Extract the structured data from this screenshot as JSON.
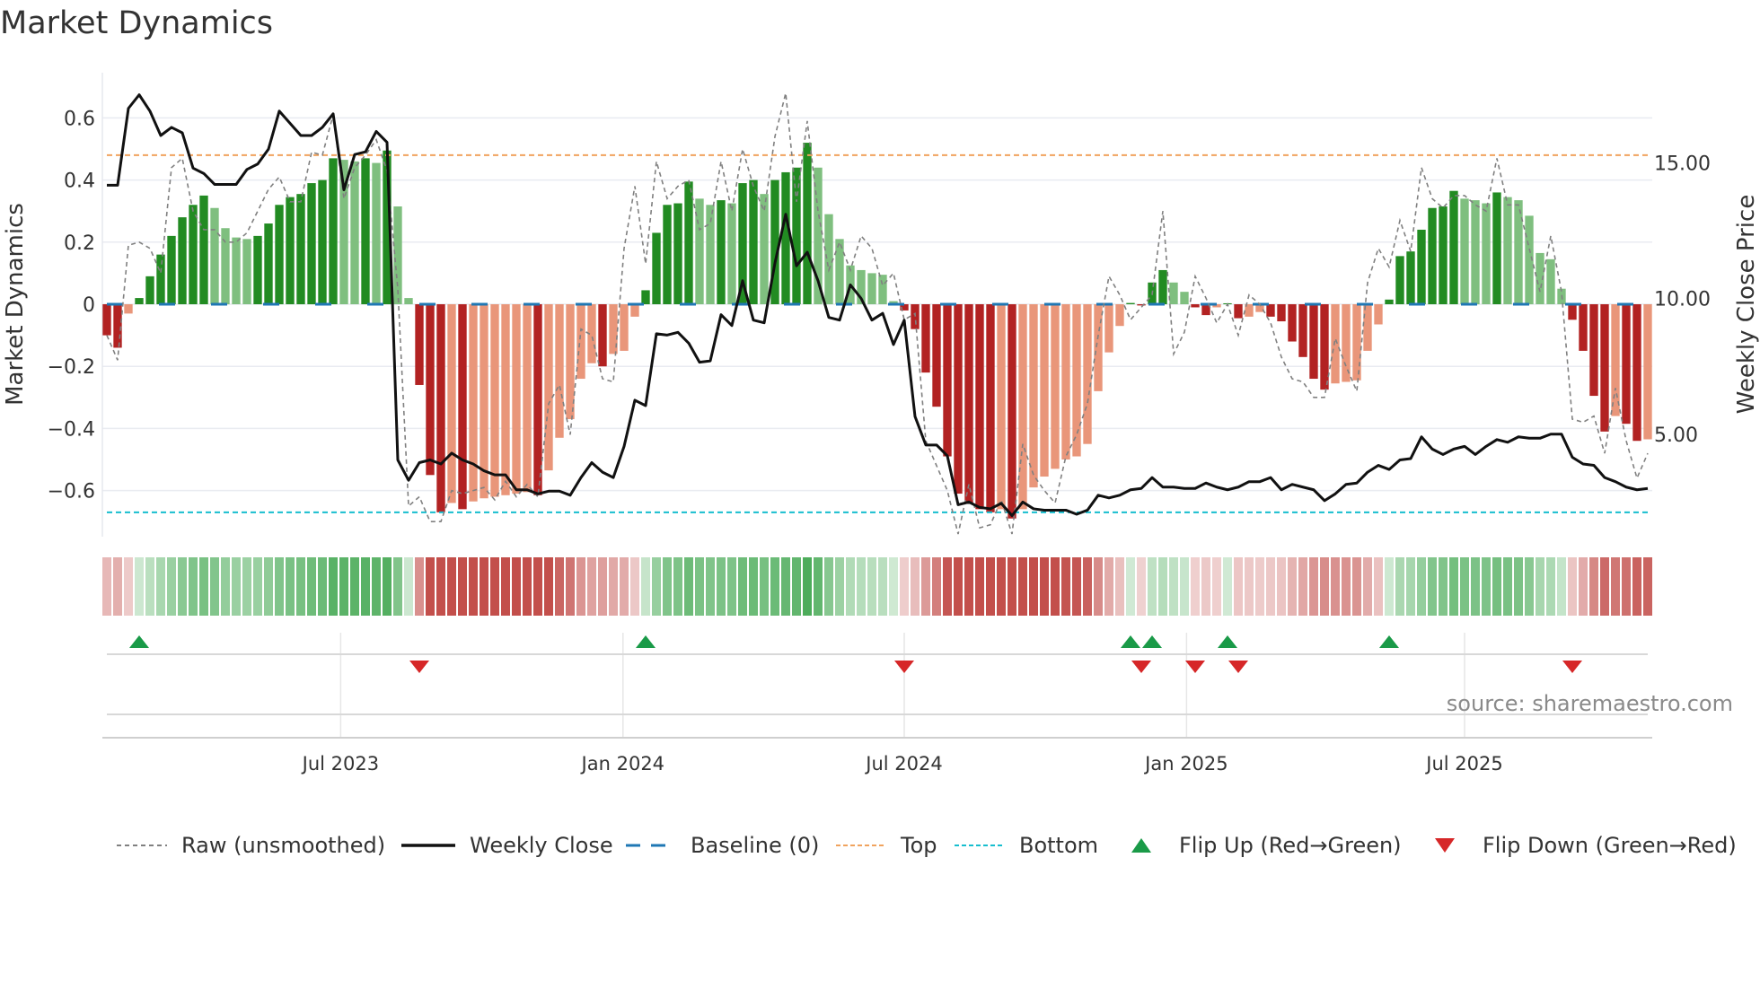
{
  "title": "Market Dynamics",
  "source": "source: sharemaestro.com",
  "colors": {
    "strong_up": "#228b22",
    "weak_up": "#7fbf7f",
    "strong_down": "#b22222",
    "weak_down": "#e9967a",
    "raw": "#808080",
    "close": "#111111",
    "baseline": "#1f77b4",
    "top": "#f0a35e",
    "bottom": "#17becf",
    "flip_up": "#1a9a48",
    "flip_down": "#d62728"
  },
  "legend": {
    "raw": "Raw (unsmoothed)",
    "close": "Weekly Close",
    "baseline": "Baseline (0)",
    "top": "Top",
    "bottom": "Bottom",
    "flip_up": "Flip Up (Red→Green)",
    "flip_down": "Flip Down (Green→Red)"
  },
  "chart_data": {
    "type": "bar",
    "title": "Market Dynamics",
    "xlabel": "",
    "ylabel": "Market Dynamics",
    "y2label": "Weekly Close Price",
    "ylim": [
      -0.75,
      0.75
    ],
    "y2lim": [
      1.25,
      18.3
    ],
    "yticks": [
      {
        "v": 0.6,
        "label": "0.6"
      },
      {
        "v": 0.4,
        "label": "0.4"
      },
      {
        "v": 0.2,
        "label": "0.2"
      },
      {
        "v": 0,
        "label": "0"
      },
      {
        "v": -0.2,
        "label": "−0.2"
      },
      {
        "v": -0.4,
        "label": "−0.4"
      },
      {
        "v": -0.6,
        "label": "−0.6"
      }
    ],
    "y2ticks": [
      {
        "v": 5,
        "label": "5.00"
      },
      {
        "v": 10,
        "label": "10.00"
      },
      {
        "v": 15,
        "label": "15.00"
      }
    ],
    "xticks": [
      {
        "week": 21.7,
        "label": "Jul 2023"
      },
      {
        "week": 47.9,
        "label": "Jan 2024"
      },
      {
        "week": 74.0,
        "label": "Jul 2024"
      },
      {
        "week": 100.2,
        "label": "Jan 2025"
      },
      {
        "week": 126.0,
        "label": "Jul 2025"
      }
    ],
    "top_level": 0.48,
    "bottom_level": -0.67,
    "baseline": 0,
    "grid": true,
    "legend_position": "bottom",
    "values": [
      -0.1,
      -0.14,
      -0.03,
      0.02,
      0.09,
      0.16,
      0.22,
      0.28,
      0.32,
      0.35,
      0.31,
      0.245,
      0.215,
      0.21,
      0.22,
      0.26,
      0.32,
      0.345,
      0.355,
      0.39,
      0.4,
      0.47,
      0.465,
      0.46,
      0.47,
      0.455,
      0.495,
      0.315,
      0.02,
      -0.26,
      -0.55,
      -0.67,
      -0.64,
      -0.66,
      -0.635,
      -0.625,
      -0.62,
      -0.615,
      -0.61,
      -0.605,
      -0.615,
      -0.535,
      -0.43,
      -0.37,
      -0.24,
      -0.19,
      -0.2,
      -0.16,
      -0.15,
      -0.04,
      0.045,
      0.23,
      0.32,
      0.325,
      0.395,
      0.34,
      0.32,
      0.335,
      0.325,
      0.39,
      0.4,
      0.355,
      0.4,
      0.425,
      0.44,
      0.52,
      0.44,
      0.29,
      0.21,
      0.125,
      0.11,
      0.1,
      0.095,
      0.01,
      -0.02,
      -0.08,
      -0.22,
      -0.33,
      -0.49,
      -0.61,
      -0.64,
      -0.66,
      -0.67,
      -0.66,
      -0.69,
      -0.66,
      -0.59,
      -0.555,
      -0.53,
      -0.5,
      -0.49,
      -0.45,
      -0.28,
      -0.155,
      -0.07,
      0.004,
      -0.004,
      0.07,
      0.11,
      0.07,
      0.04,
      -0.01,
      -0.035,
      -0.01,
      0.003,
      -0.045,
      -0.04,
      -0.025,
      -0.04,
      -0.055,
      -0.12,
      -0.17,
      -0.24,
      -0.275,
      -0.255,
      -0.25,
      -0.245,
      -0.15,
      -0.065,
      0.015,
      0.155,
      0.17,
      0.24,
      0.31,
      0.315,
      0.365,
      0.34,
      0.335,
      0.325,
      0.36,
      0.345,
      0.335,
      0.285,
      0.165,
      0.145,
      0.05,
      -0.05,
      -0.15,
      -0.295,
      -0.41,
      -0.36,
      -0.385,
      -0.44,
      -0.435
    ],
    "raw": [
      -0.1,
      -0.18,
      0.19,
      0.2,
      0.18,
      0.1,
      0.44,
      0.47,
      0.3,
      0.24,
      0.24,
      0.2,
      0.2,
      0.23,
      0.3,
      0.37,
      0.41,
      0.33,
      0.33,
      0.49,
      0.48,
      0.61,
      0.34,
      0.44,
      0.48,
      0.53,
      0.43,
      0.05,
      -0.65,
      -0.62,
      -0.7,
      -0.7,
      -0.6,
      -0.61,
      -0.6,
      -0.59,
      -0.63,
      -0.57,
      -0.62,
      -0.58,
      -0.62,
      -0.32,
      -0.26,
      -0.42,
      -0.08,
      -0.1,
      -0.24,
      -0.25,
      0.18,
      0.38,
      0.13,
      0.46,
      0.34,
      0.38,
      0.4,
      0.24,
      0.26,
      0.46,
      0.3,
      0.5,
      0.38,
      0.3,
      0.54,
      0.68,
      0.33,
      0.59,
      0.3,
      0.11,
      0.2,
      0.11,
      0.22,
      0.18,
      0.06,
      0.1,
      -0.05,
      -0.03,
      -0.44,
      -0.52,
      -0.6,
      -0.74,
      -0.58,
      -0.72,
      -0.71,
      -0.63,
      -0.74,
      -0.45,
      -0.55,
      -0.6,
      -0.64,
      -0.49,
      -0.42,
      -0.32,
      -0.1,
      0.09,
      0.03,
      -0.05,
      -0.01,
      0.03,
      0.3,
      -0.16,
      -0.09,
      0.09,
      0.02,
      -0.06,
      0.0,
      -0.1,
      0.03,
      0.0,
      -0.06,
      -0.17,
      -0.24,
      -0.25,
      -0.3,
      -0.3,
      -0.11,
      -0.2,
      -0.28,
      0.07,
      0.18,
      0.12,
      0.27,
      0.17,
      0.44,
      0.34,
      0.31,
      0.35,
      0.35,
      0.32,
      0.3,
      0.47,
      0.32,
      0.32,
      0.18,
      0.04,
      0.22,
      0.04,
      -0.37,
      -0.38,
      -0.36,
      -0.48,
      -0.27,
      -0.44,
      -0.56,
      -0.48
    ],
    "close": [
      14.17,
      14.17,
      17.0,
      17.5,
      16.9,
      16.0,
      16.3,
      16.1,
      14.8,
      14.6,
      14.2,
      14.2,
      14.2,
      14.75,
      14.95,
      15.5,
      16.9,
      16.45,
      16.0,
      16.0,
      16.3,
      16.8,
      14.0,
      15.3,
      15.4,
      16.15,
      15.75,
      4.05,
      3.3,
      3.95,
      4.05,
      3.9,
      4.3,
      4.05,
      3.9,
      3.65,
      3.5,
      3.5,
      2.95,
      2.95,
      2.8,
      2.9,
      2.9,
      2.75,
      3.4,
      3.95,
      3.6,
      3.4,
      4.55,
      6.25,
      6.05,
      8.7,
      8.65,
      8.75,
      8.35,
      7.65,
      7.7,
      9.4,
      9.0,
      10.65,
      9.2,
      9.1,
      11.3,
      13.1,
      11.2,
      11.7,
      10.65,
      9.3,
      9.2,
      10.5,
      10.0,
      9.2,
      9.45,
      8.3,
      9.2,
      5.65,
      4.6,
      4.6,
      4.2,
      2.4,
      2.5,
      2.3,
      2.25,
      2.45,
      2.0,
      2.5,
      2.25,
      2.2,
      2.2,
      2.2,
      2.05,
      2.2,
      2.75,
      2.65,
      2.75,
      2.95,
      3.0,
      3.4,
      3.05,
      3.05,
      3.0,
      3.0,
      3.2,
      3.05,
      2.95,
      3.05,
      3.25,
      3.25,
      3.4,
      2.95,
      3.15,
      3.05,
      2.95,
      2.55,
      2.8,
      3.15,
      3.2,
      3.6,
      3.85,
      3.7,
      4.05,
      4.1,
      4.9,
      4.45,
      4.25,
      4.45,
      4.55,
      4.25,
      4.55,
      4.8,
      4.7,
      4.9,
      4.85,
      4.85,
      5.0,
      5.0,
      4.15,
      3.9,
      3.85,
      3.4,
      3.25,
      3.05,
      2.95,
      3.0
    ]
  }
}
